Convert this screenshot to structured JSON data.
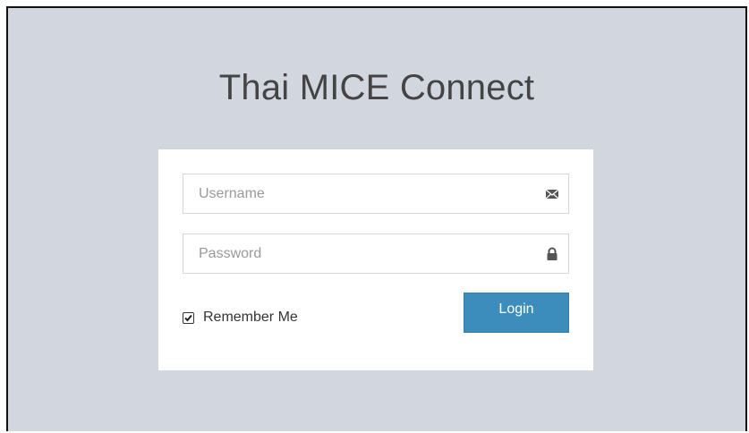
{
  "app": {
    "title": "Thai MICE Connect"
  },
  "login_form": {
    "username": {
      "placeholder": "Username",
      "value": "",
      "icon": "envelope-icon"
    },
    "password": {
      "placeholder": "Password",
      "value": "",
      "icon": "lock-icon"
    },
    "remember_me": {
      "label": "Remember Me",
      "checked": true
    },
    "login_button_label": "Login"
  },
  "colors": {
    "background": "#d2d6de",
    "card": "#ffffff",
    "primary_button": "#3c8dbc",
    "title_text": "#444444",
    "input_border": "#d2d6de"
  }
}
